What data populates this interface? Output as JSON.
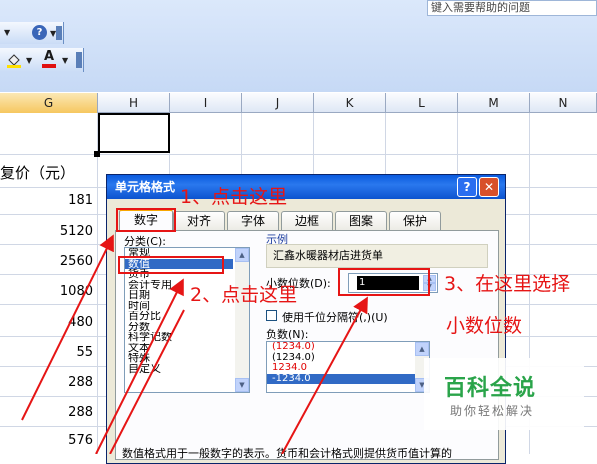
{
  "toolbar": {
    "help_placeholder": "键入需要帮助的问题",
    "help_icon": "?",
    "font_color_icon": "A"
  },
  "columns": [
    "G",
    "H",
    "I",
    "J",
    "K",
    "L",
    "M",
    "N"
  ],
  "column_g": {
    "header_text": "复价（元）",
    "values": [
      "181",
      "5120",
      "2560",
      "1080",
      "480",
      "55",
      "288",
      "288",
      "576"
    ]
  },
  "dialog": {
    "title": "单元格格式",
    "help_btn": "?",
    "close_btn": "✕",
    "tabs": [
      "数字",
      "对齐",
      "字体",
      "边框",
      "图案",
      "保护"
    ],
    "category_label": "分类(C):",
    "categories": [
      "常规",
      "数值",
      "货币",
      "会计专用",
      "日期",
      "时间",
      "百分比",
      "分数",
      "科学记数",
      "文本",
      "特殊",
      "自定义"
    ],
    "selected_category": "数值",
    "sample_label": "示例",
    "sample_value": "汇鑫水暖器材店进货单",
    "decimal_label": "小数位数(D):",
    "decimal_value": "1",
    "thousands_label": "使用千位分隔符(,)(U)",
    "negative_label": "负数(N):",
    "negative_options": [
      "(1234.0)",
      "(1234.0)",
      "1234.0",
      "-1234.0"
    ],
    "description": "数值格式用于一般数字的表示。货币和会计格式则提供货币值计算的"
  },
  "annotations": {
    "step1": "1、点击这里",
    "step2": "2、点击这里",
    "step3_line1": "3、在这里选择",
    "step3_line2": "小数位数",
    "color": "#e61515"
  },
  "watermark": {
    "title": "百科全说",
    "subtitle": "助你轻松解决"
  }
}
